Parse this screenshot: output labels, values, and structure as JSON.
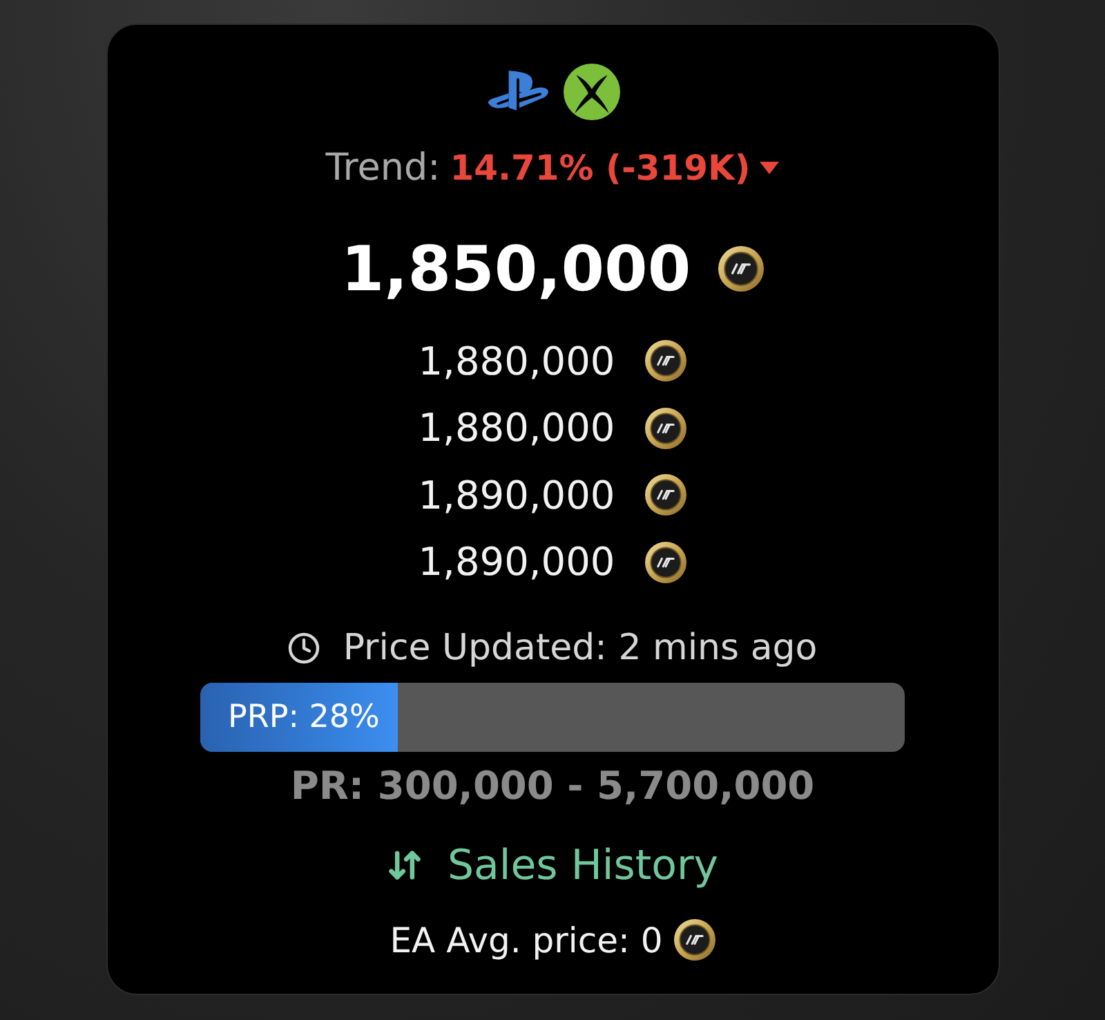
{
  "trend": {
    "label": "Trend:",
    "value": "14.71% (-319K)",
    "falling": true
  },
  "price": "1,850,000",
  "listings": [
    "1,880,000",
    "1,880,000",
    "1,890,000",
    "1,890,000"
  ],
  "updated": "Price Updated: 2 mins ago",
  "prp": {
    "label": "PRP: 28%",
    "level": 0.28
  },
  "price_range": "PR: 300,000 - 5,700,000",
  "sales_history": "Sales History",
  "ea_avg": "EA Avg. price: 0"
}
